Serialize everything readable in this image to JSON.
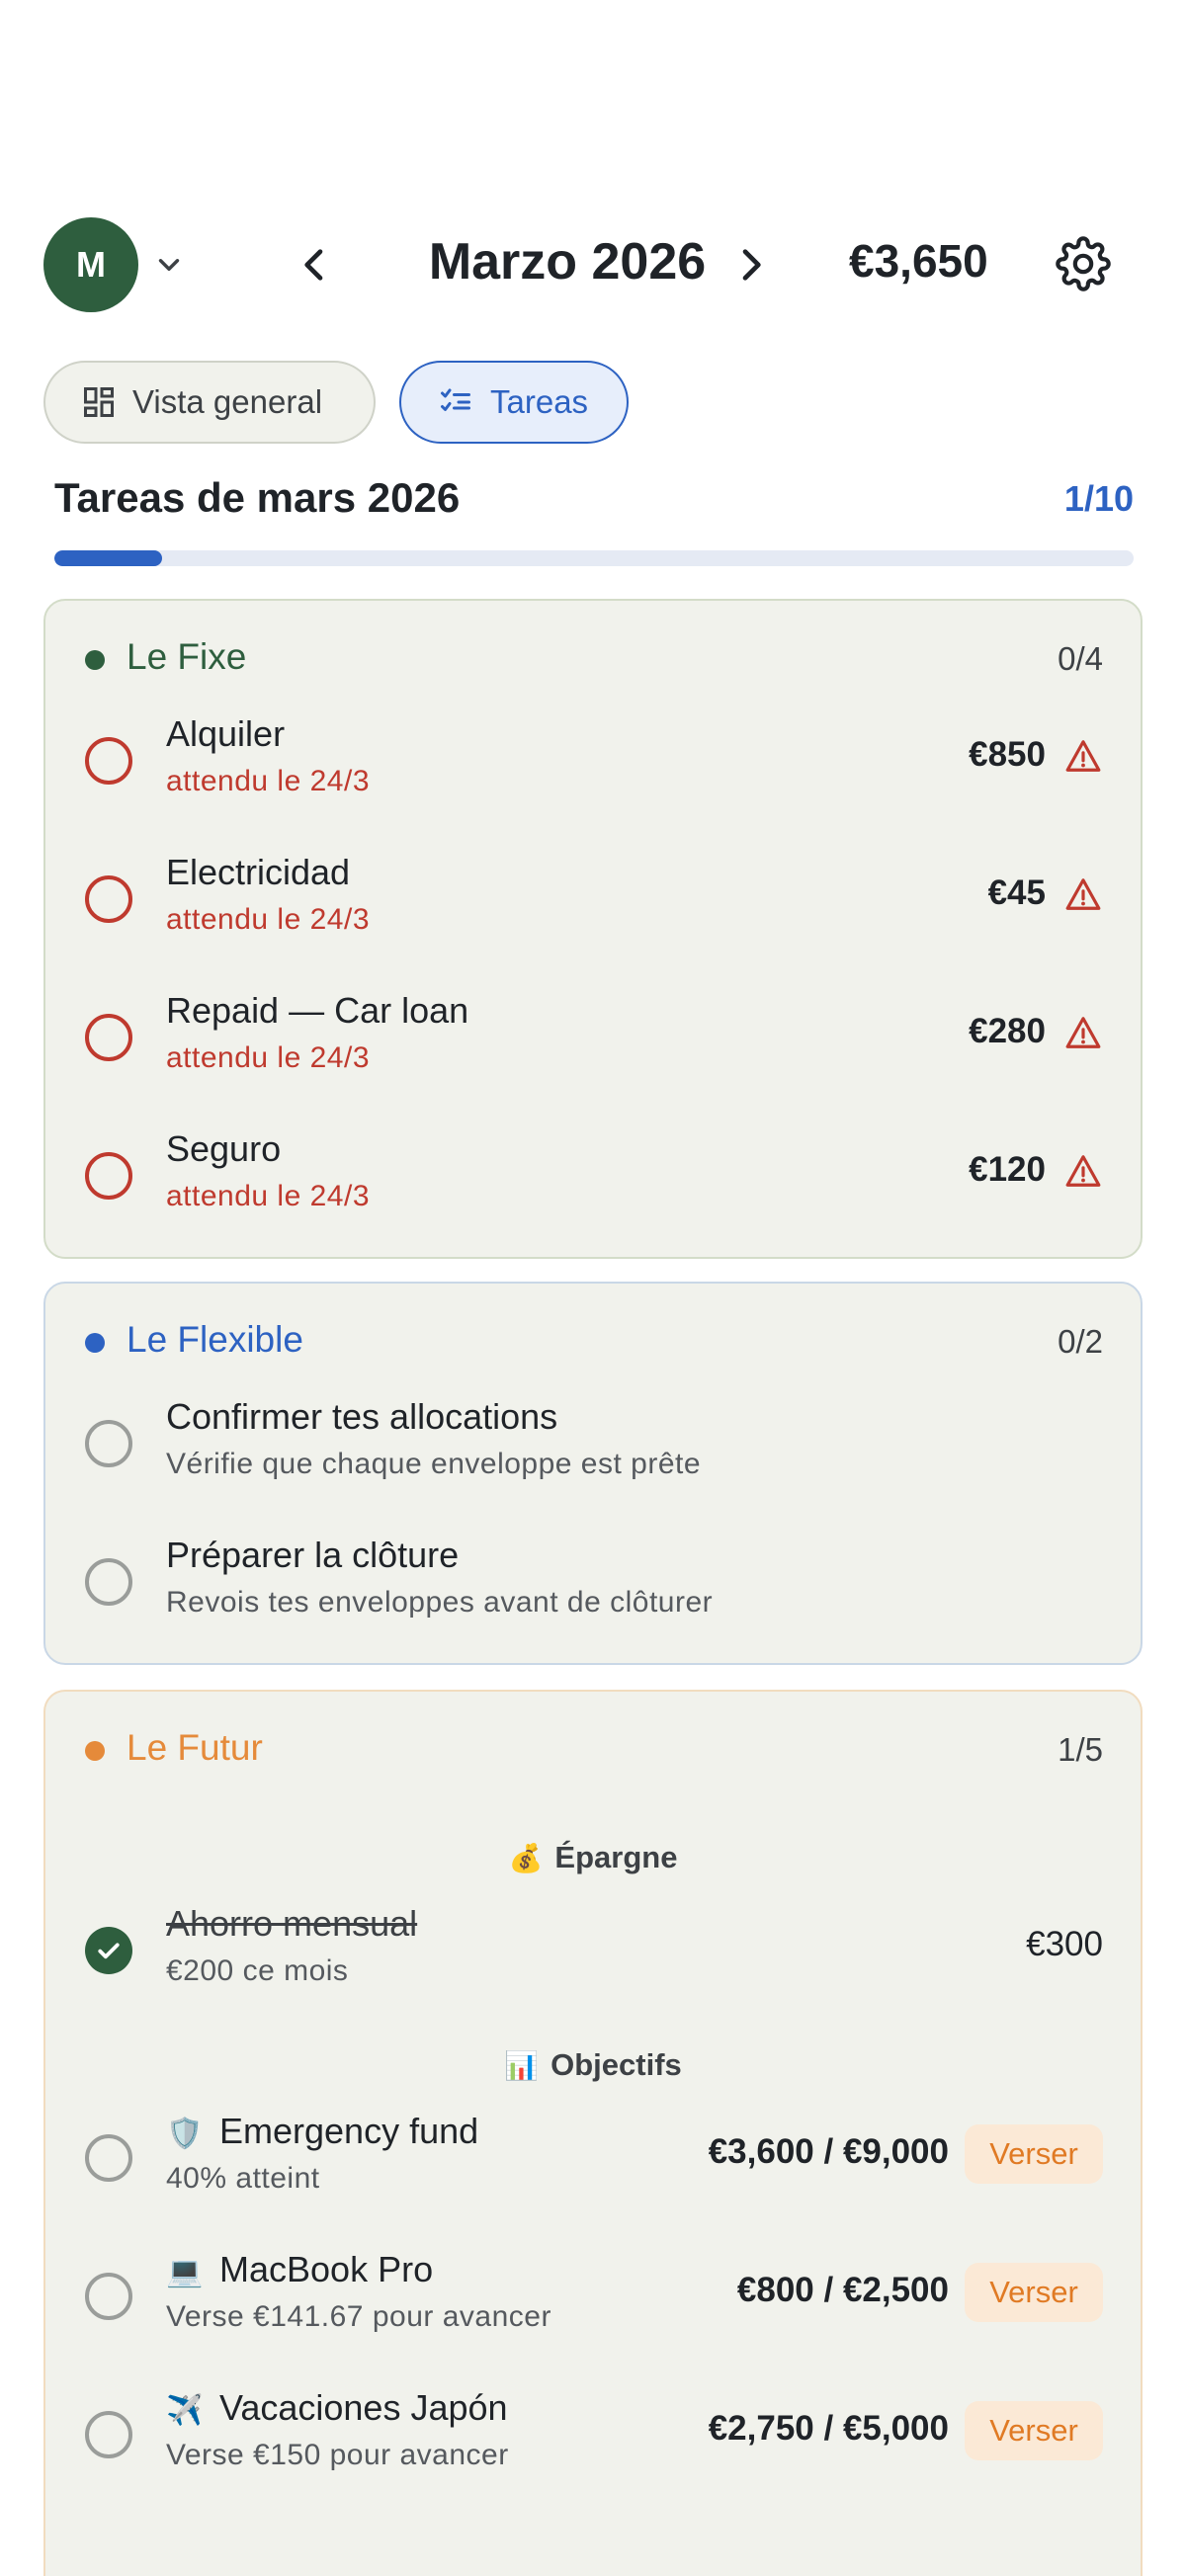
{
  "header": {
    "avatar_initial": "M",
    "month_title": "Marzo 2026",
    "balance": "€3,650"
  },
  "tabs": [
    {
      "label": "Vista general",
      "active": false
    },
    {
      "label": "Tareas",
      "active": true
    }
  ],
  "tasks": {
    "title": "Tareas de mars 2026",
    "count": "1/10",
    "progress": 0.1
  },
  "colors": {
    "fixe": "#2e5e3e",
    "flexible": "#2d62c2",
    "futur": "#e58a3a",
    "overdue": "#bf3a2e"
  },
  "sections": {
    "fixe": {
      "title": "Le Fixe",
      "count": "0/4",
      "items": [
        {
          "title": "Alquiler",
          "subtitle": "attendu le 24/3",
          "amount": "€850"
        },
        {
          "title": "Electricidad",
          "subtitle": "attendu le 24/3",
          "amount": "€45"
        },
        {
          "title": "Repaid — Car loan",
          "subtitle": "attendu le 24/3",
          "amount": "€280"
        },
        {
          "title": "Seguro",
          "subtitle": "attendu le 24/3",
          "amount": "€120"
        }
      ]
    },
    "flexible": {
      "title": "Le Flexible",
      "count": "0/2",
      "items": [
        {
          "title": "Confirmer tes allocations",
          "subtitle": "Vérifie que chaque enveloppe est prête"
        },
        {
          "title": "Préparer la clôture",
          "subtitle": "Revois tes enveloppes avant de clôturer"
        }
      ]
    },
    "futur": {
      "title": "Le Futur",
      "count": "1/5",
      "savings_group": {
        "emoji": "💰",
        "label": "Épargne"
      },
      "savings_item": {
        "title": "Ahorro mensual",
        "subtitle": "€200 ce mois",
        "amount": "€300",
        "done": true
      },
      "goals_group": {
        "emoji": "📊",
        "label": "Objectifs"
      },
      "goals": [
        {
          "emoji": "🛡️",
          "title": "Emergency fund",
          "subtitle": "40% atteint",
          "amount": "€3,600 / €9,000",
          "action": "Verser"
        },
        {
          "emoji": "💻",
          "title": "MacBook Pro",
          "subtitle": "Verse €141.67 pour avancer",
          "amount": "€800 / €2,500",
          "action": "Verser"
        },
        {
          "emoji": "✈️",
          "title": "Vacaciones Japón",
          "subtitle": "Verse €150 pour avancer",
          "amount": "€2,750 / €5,000",
          "action": "Verser"
        }
      ]
    }
  }
}
